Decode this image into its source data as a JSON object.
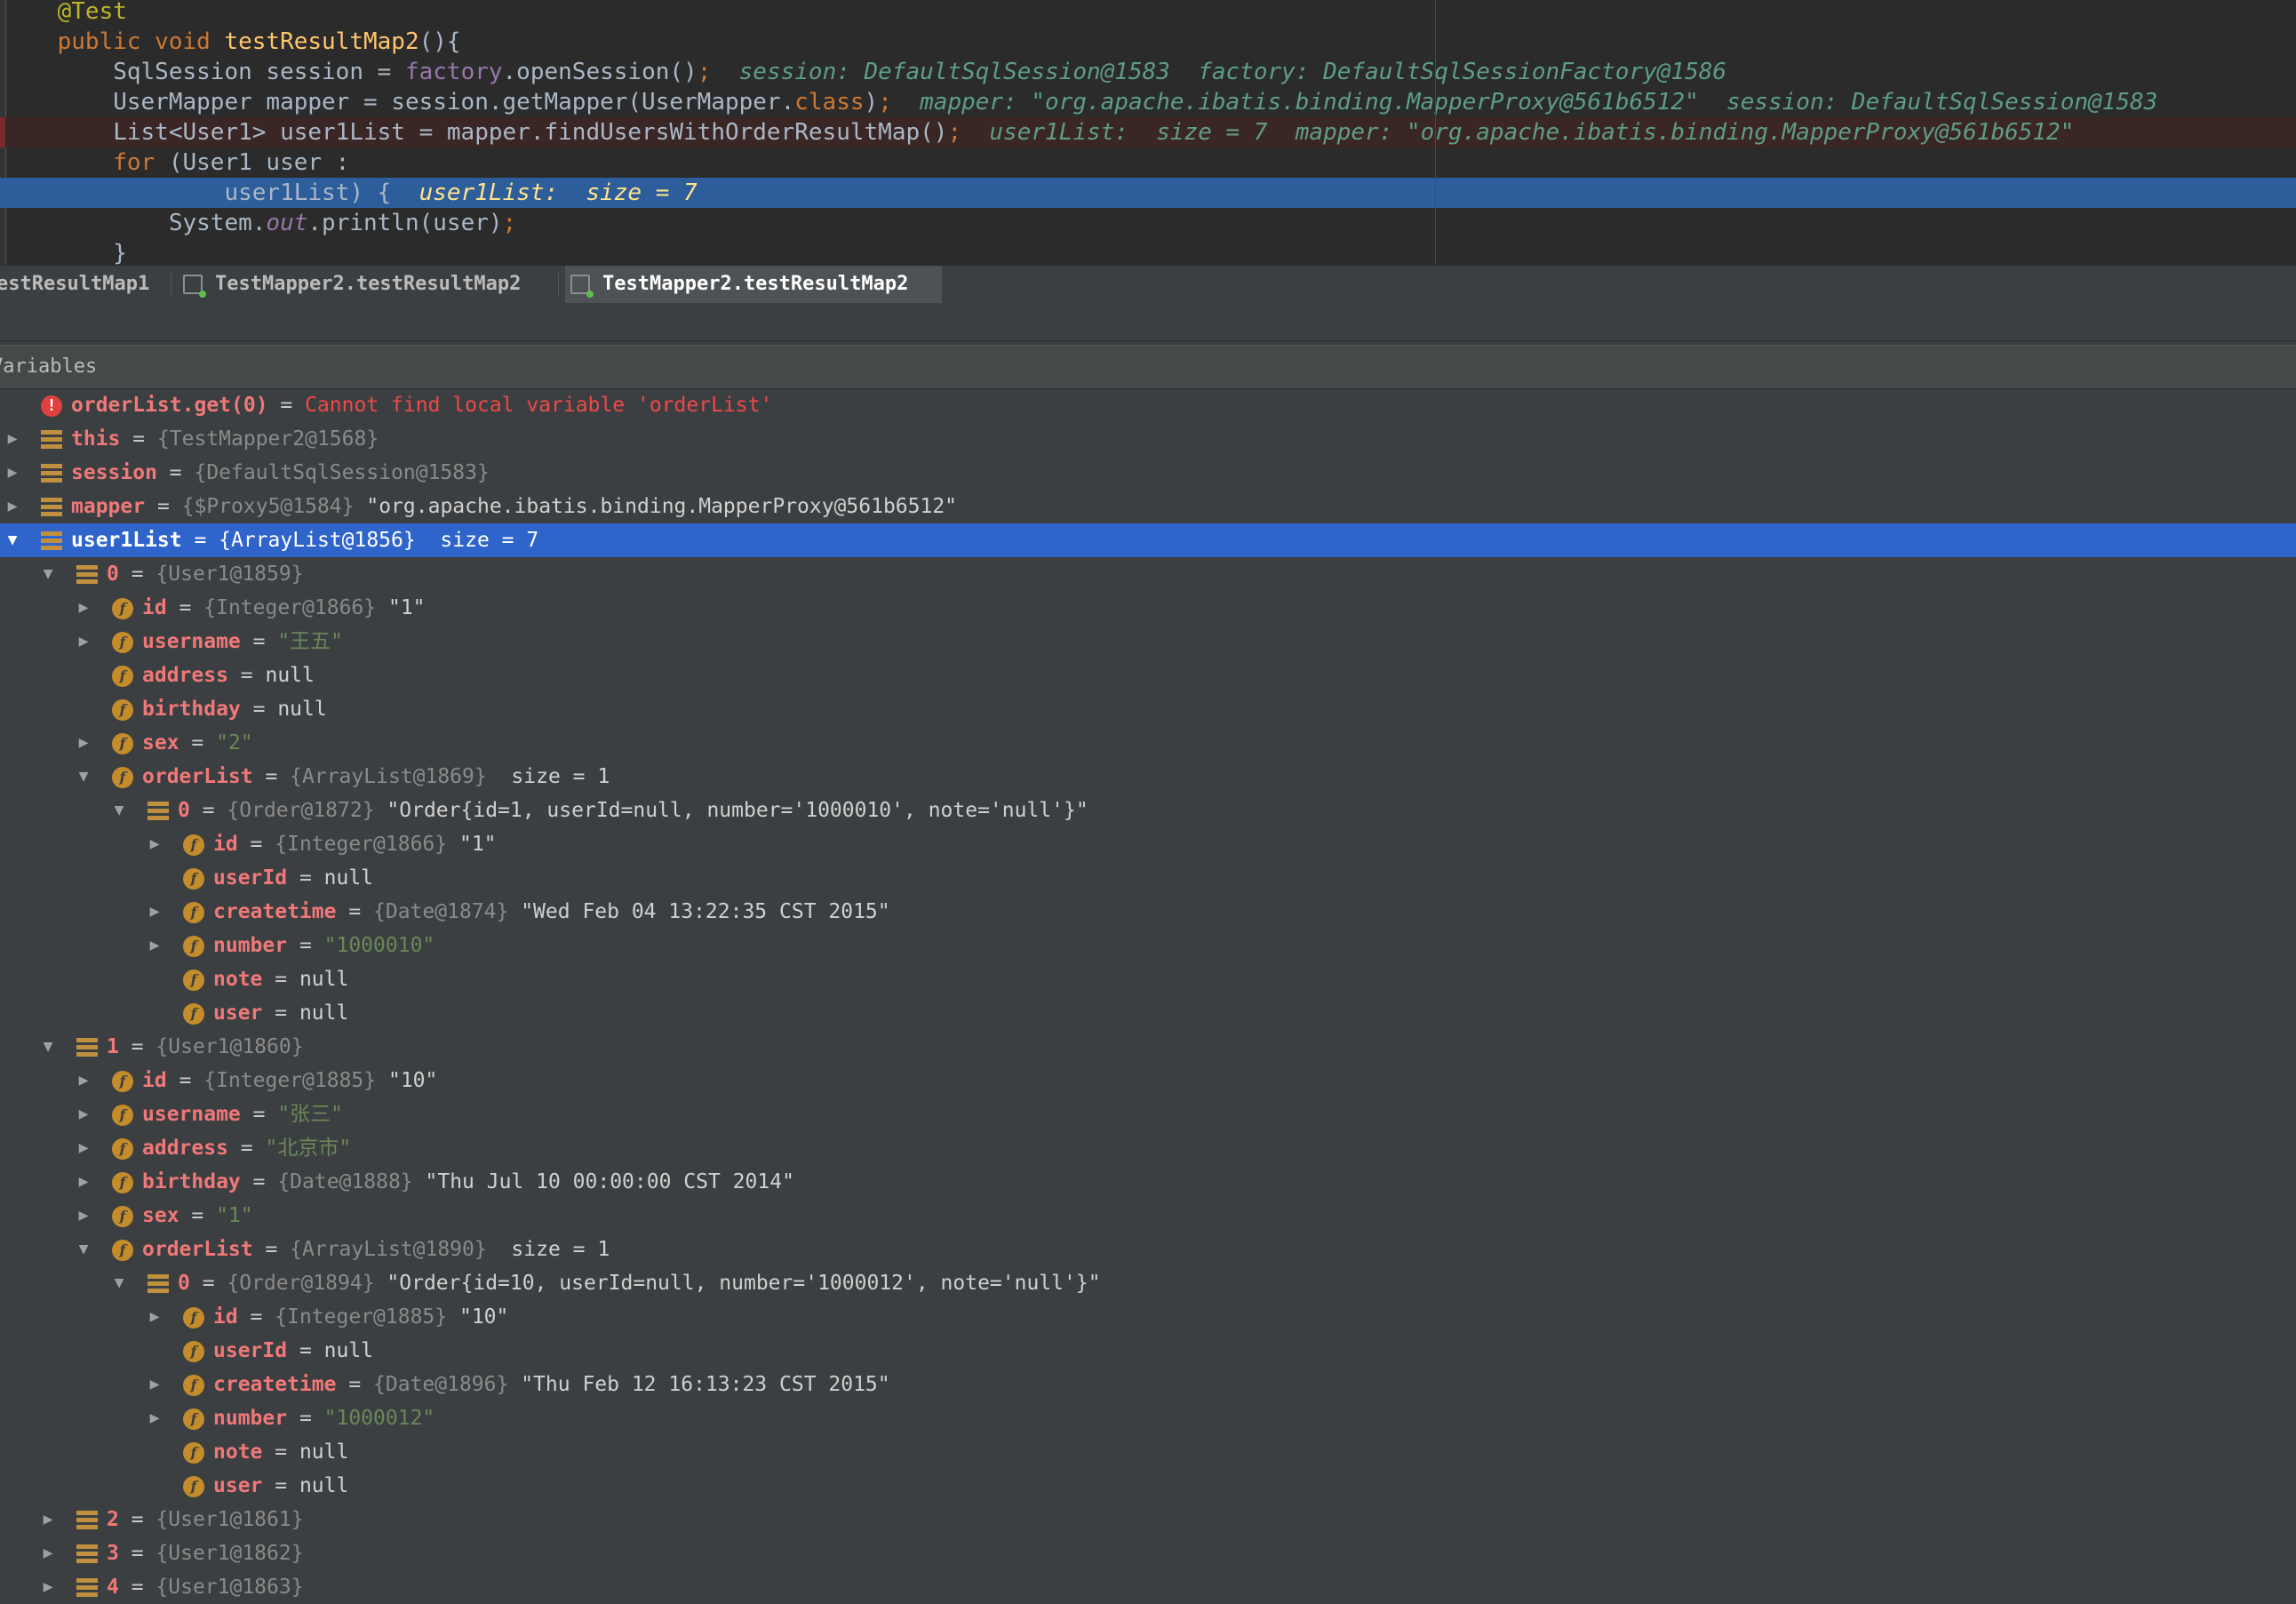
{
  "editor": {
    "lines": [
      {
        "id": "l0",
        "type": "normal",
        "segments": [
          {
            "c": "ann",
            "t": "    @Test"
          }
        ]
      },
      {
        "id": "l1",
        "type": "normal",
        "segments": [
          {
            "c": "kw",
            "t": "    public void "
          },
          {
            "c": "fn",
            "t": "testResultMap2"
          },
          {
            "c": "plain",
            "t": "(){"
          }
        ]
      },
      {
        "id": "l2",
        "type": "normal",
        "segments": [
          {
            "c": "plain",
            "t": "        SqlSession session = "
          },
          {
            "c": "fld",
            "t": "factory"
          },
          {
            "c": "plain",
            "t": ".openSession()"
          },
          {
            "c": "kw",
            "t": ";"
          },
          {
            "c": "hint",
            "t": "  session: DefaultSqlSession@1583  factory: DefaultSqlSessionFactory@1586"
          }
        ]
      },
      {
        "id": "l3",
        "type": "normal",
        "segments": [
          {
            "c": "plain",
            "t": "        UserMapper mapper = session.getMapper(UserMapper."
          },
          {
            "c": "kw",
            "t": "class"
          },
          {
            "c": "plain",
            "t": ")"
          },
          {
            "c": "kw",
            "t": ";"
          },
          {
            "c": "hint",
            "t": "  mapper: \"org.apache.ibatis.binding.MapperProxy@561b6512\"  session: DefaultSqlSession@1583"
          }
        ]
      },
      {
        "id": "l4",
        "type": "err",
        "segments": [
          {
            "c": "plain",
            "t": "        List<User1> user1List = mapper.findUsersWithOrderResultMap()"
          },
          {
            "c": "kw",
            "t": ";"
          },
          {
            "c": "hint",
            "t": "  user1List:  size = 7  mapper: \"org.apache.ibatis.binding.MapperProxy@561b6512\""
          }
        ]
      },
      {
        "id": "l5",
        "type": "normal",
        "segments": [
          {
            "c": "kw",
            "t": "        for "
          },
          {
            "c": "plain",
            "t": "(User1 user :"
          }
        ]
      },
      {
        "id": "l6",
        "type": "cur",
        "segments": [
          {
            "c": "plain",
            "t": "                user1List) {  "
          },
          {
            "c": "hint-cur",
            "t": "user1List:  size = 7"
          }
        ]
      },
      {
        "id": "l7",
        "type": "normal",
        "segments": [
          {
            "c": "plain",
            "t": "            System."
          },
          {
            "c": "fld ital",
            "t": "out"
          },
          {
            "c": "plain",
            "t": ".println(user)"
          },
          {
            "c": "kw",
            "t": ";"
          }
        ]
      },
      {
        "id": "l8",
        "type": "normal",
        "segments": [
          {
            "c": "plain",
            "t": "        }"
          }
        ]
      }
    ]
  },
  "tabs": [
    {
      "label": "estResultMap1",
      "active": false
    },
    {
      "label": "TestMapper2.testResultMap2",
      "active": false
    },
    {
      "label": "TestMapper2.testResultMap2",
      "active": true
    }
  ],
  "variables_header": "Variables",
  "tree": [
    {
      "depth": 0,
      "arrow": "",
      "icon": "err",
      "name": "orderList.get(0)",
      "parts": [
        {
          "c": "err-msg",
          "t": "Cannot find local variable 'orderList'"
        }
      ]
    },
    {
      "depth": 0,
      "arrow": "▶",
      "icon": "bar",
      "name": "this",
      "parts": [
        {
          "c": "ref",
          "t": "{TestMapper2@1568}"
        }
      ]
    },
    {
      "depth": 0,
      "arrow": "▶",
      "icon": "bar",
      "name": "session",
      "parts": [
        {
          "c": "ref",
          "t": "{DefaultSqlSession@1583}"
        }
      ]
    },
    {
      "depth": 0,
      "arrow": "▶",
      "icon": "bar",
      "name": "mapper",
      "parts": [
        {
          "c": "ref",
          "t": "{$Proxy5@1584} "
        },
        {
          "c": "v",
          "t": "\"org.apache.ibatis.binding.MapperProxy@561b6512\""
        }
      ]
    },
    {
      "depth": 0,
      "arrow": "▼",
      "icon": "bar",
      "name": "user1List",
      "sel": true,
      "parts": [
        {
          "c": "v",
          "t": "{ArrayList@1856}  size = 7"
        }
      ]
    },
    {
      "depth": 1,
      "arrow": "▼",
      "icon": "bar",
      "name": "0",
      "parts": [
        {
          "c": "ref",
          "t": "{User1@1859}"
        }
      ]
    },
    {
      "depth": 2,
      "arrow": "▶",
      "icon": "f",
      "name": "id",
      "parts": [
        {
          "c": "ref",
          "t": "{Integer@1866} "
        },
        {
          "c": "v",
          "t": "\"1\""
        }
      ]
    },
    {
      "depth": 2,
      "arrow": "▶",
      "icon": "f",
      "name": "username",
      "parts": [
        {
          "c": "s",
          "t": "\"王五\""
        }
      ]
    },
    {
      "depth": 2,
      "arrow": "",
      "icon": "f",
      "name": "address",
      "parts": [
        {
          "c": "v",
          "t": "null"
        }
      ]
    },
    {
      "depth": 2,
      "arrow": "",
      "icon": "f",
      "name": "birthday",
      "parts": [
        {
          "c": "v",
          "t": "null"
        }
      ]
    },
    {
      "depth": 2,
      "arrow": "▶",
      "icon": "f",
      "name": "sex",
      "parts": [
        {
          "c": "s",
          "t": "\"2\""
        }
      ]
    },
    {
      "depth": 2,
      "arrow": "▼",
      "icon": "f",
      "name": "orderList",
      "parts": [
        {
          "c": "ref",
          "t": "{ArrayList@1869}  "
        },
        {
          "c": "v",
          "t": "size = 1"
        }
      ]
    },
    {
      "depth": 3,
      "arrow": "▼",
      "icon": "bar",
      "name": "0",
      "parts": [
        {
          "c": "ref",
          "t": "{Order@1872} "
        },
        {
          "c": "v",
          "t": "\"Order{id=1, userId=null, number='1000010', note='null'}\""
        }
      ]
    },
    {
      "depth": 4,
      "arrow": "▶",
      "icon": "f",
      "name": "id",
      "parts": [
        {
          "c": "ref",
          "t": "{Integer@1866} "
        },
        {
          "c": "v",
          "t": "\"1\""
        }
      ]
    },
    {
      "depth": 4,
      "arrow": "",
      "icon": "f",
      "name": "userId",
      "parts": [
        {
          "c": "v",
          "t": "null"
        }
      ]
    },
    {
      "depth": 4,
      "arrow": "▶",
      "icon": "f",
      "name": "createtime",
      "parts": [
        {
          "c": "ref",
          "t": "{Date@1874} "
        },
        {
          "c": "v",
          "t": "\"Wed Feb 04 13:22:35 CST 2015\""
        }
      ]
    },
    {
      "depth": 4,
      "arrow": "▶",
      "icon": "f",
      "name": "number",
      "parts": [
        {
          "c": "s",
          "t": "\"1000010\""
        }
      ]
    },
    {
      "depth": 4,
      "arrow": "",
      "icon": "f",
      "name": "note",
      "parts": [
        {
          "c": "v",
          "t": "null"
        }
      ]
    },
    {
      "depth": 4,
      "arrow": "",
      "icon": "f",
      "name": "user",
      "parts": [
        {
          "c": "v",
          "t": "null"
        }
      ]
    },
    {
      "depth": 1,
      "arrow": "▼",
      "icon": "bar",
      "name": "1",
      "parts": [
        {
          "c": "ref",
          "t": "{User1@1860}"
        }
      ]
    },
    {
      "depth": 2,
      "arrow": "▶",
      "icon": "f",
      "name": "id",
      "parts": [
        {
          "c": "ref",
          "t": "{Integer@1885} "
        },
        {
          "c": "v",
          "t": "\"10\""
        }
      ]
    },
    {
      "depth": 2,
      "arrow": "▶",
      "icon": "f",
      "name": "username",
      "parts": [
        {
          "c": "s",
          "t": "\"张三\""
        }
      ]
    },
    {
      "depth": 2,
      "arrow": "▶",
      "icon": "f",
      "name": "address",
      "parts": [
        {
          "c": "s",
          "t": "\"北京市\""
        }
      ]
    },
    {
      "depth": 2,
      "arrow": "▶",
      "icon": "f",
      "name": "birthday",
      "parts": [
        {
          "c": "ref",
          "t": "{Date@1888} "
        },
        {
          "c": "v",
          "t": "\"Thu Jul 10 00:00:00 CST 2014\""
        }
      ]
    },
    {
      "depth": 2,
      "arrow": "▶",
      "icon": "f",
      "name": "sex",
      "parts": [
        {
          "c": "s",
          "t": "\"1\""
        }
      ]
    },
    {
      "depth": 2,
      "arrow": "▼",
      "icon": "f",
      "name": "orderList",
      "parts": [
        {
          "c": "ref",
          "t": "{ArrayList@1890}  "
        },
        {
          "c": "v",
          "t": "size = 1"
        }
      ]
    },
    {
      "depth": 3,
      "arrow": "▼",
      "icon": "bar",
      "name": "0",
      "parts": [
        {
          "c": "ref",
          "t": "{Order@1894} "
        },
        {
          "c": "v",
          "t": "\"Order{id=10, userId=null, number='1000012', note='null'}\""
        }
      ]
    },
    {
      "depth": 4,
      "arrow": "▶",
      "icon": "f",
      "name": "id",
      "parts": [
        {
          "c": "ref",
          "t": "{Integer@1885} "
        },
        {
          "c": "v",
          "t": "\"10\""
        }
      ]
    },
    {
      "depth": 4,
      "arrow": "",
      "icon": "f",
      "name": "userId",
      "parts": [
        {
          "c": "v",
          "t": "null"
        }
      ]
    },
    {
      "depth": 4,
      "arrow": "▶",
      "icon": "f",
      "name": "createtime",
      "parts": [
        {
          "c": "ref",
          "t": "{Date@1896} "
        },
        {
          "c": "v",
          "t": "\"Thu Feb 12 16:13:23 CST 2015\""
        }
      ]
    },
    {
      "depth": 4,
      "arrow": "▶",
      "icon": "f",
      "name": "number",
      "parts": [
        {
          "c": "s",
          "t": "\"1000012\""
        }
      ]
    },
    {
      "depth": 4,
      "arrow": "",
      "icon": "f",
      "name": "note",
      "parts": [
        {
          "c": "v",
          "t": "null"
        }
      ]
    },
    {
      "depth": 4,
      "arrow": "",
      "icon": "f",
      "name": "user",
      "parts": [
        {
          "c": "v",
          "t": "null"
        }
      ]
    },
    {
      "depth": 1,
      "arrow": "▶",
      "icon": "bar",
      "name": "2",
      "parts": [
        {
          "c": "ref",
          "t": "{User1@1861}"
        }
      ]
    },
    {
      "depth": 1,
      "arrow": "▶",
      "icon": "bar",
      "name": "3",
      "parts": [
        {
          "c": "ref",
          "t": "{User1@1862}"
        }
      ]
    },
    {
      "depth": 1,
      "arrow": "▶",
      "icon": "bar",
      "name": "4",
      "parts": [
        {
          "c": "ref",
          "t": "{User1@1863}"
        }
      ]
    }
  ]
}
